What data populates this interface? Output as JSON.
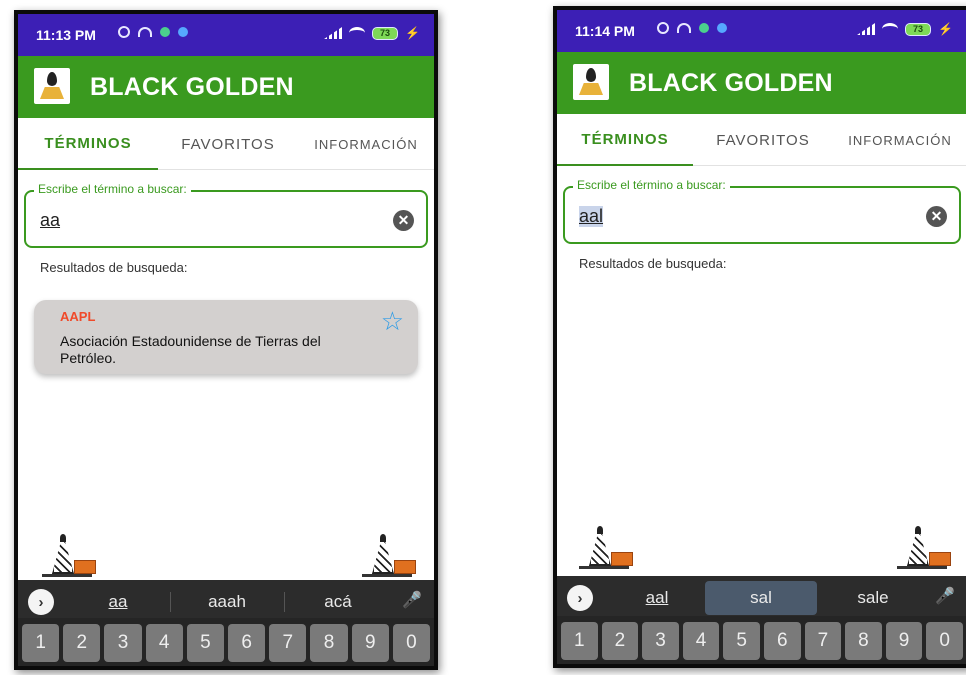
{
  "colors": {
    "status_bar": "#3c1fb5",
    "app_bar": "#3a9a1f",
    "accent": "#3a8f1f",
    "term": "#f04a2a",
    "star": "#2d9be6",
    "card": "#d3d0cf"
  },
  "left": {
    "status": {
      "time": "11:13 PM",
      "battery": "73"
    },
    "app": {
      "title": "BLACK GOLDEN",
      "logo_icon": "oil-gold-logo-icon"
    },
    "tabs": [
      "TÉRMINOS",
      "FAVORITOS",
      "INFORMACIÓN"
    ],
    "search": {
      "legend": "Escribe el término a buscar:",
      "value": "aa"
    },
    "results_label": "Resultados de busqueda:",
    "results": [
      {
        "term": "AAPL",
        "description": "Asociación Estadounidense de Tierras del Petróleo."
      }
    ],
    "suggestions": [
      "aa",
      "aaah",
      "acá"
    ],
    "numbers": [
      "1",
      "2",
      "3",
      "4",
      "5",
      "6",
      "7",
      "8",
      "9",
      "0"
    ]
  },
  "right": {
    "status": {
      "time": "11:14 PM",
      "battery": "73"
    },
    "app": {
      "title": "BLACK GOLDEN",
      "logo_icon": "oil-gold-logo-icon"
    },
    "tabs": [
      "TÉRMINOS",
      "FAVORITOS",
      "INFORMACIÓN"
    ],
    "search": {
      "legend": "Escribe el término a buscar:",
      "value": "aal"
    },
    "results_label": "Resultados de busqueda:",
    "suggestions": [
      "aal",
      "sal",
      "sale"
    ],
    "numbers": [
      "1",
      "2",
      "3",
      "4",
      "5",
      "6",
      "7",
      "8",
      "9",
      "0"
    ]
  }
}
